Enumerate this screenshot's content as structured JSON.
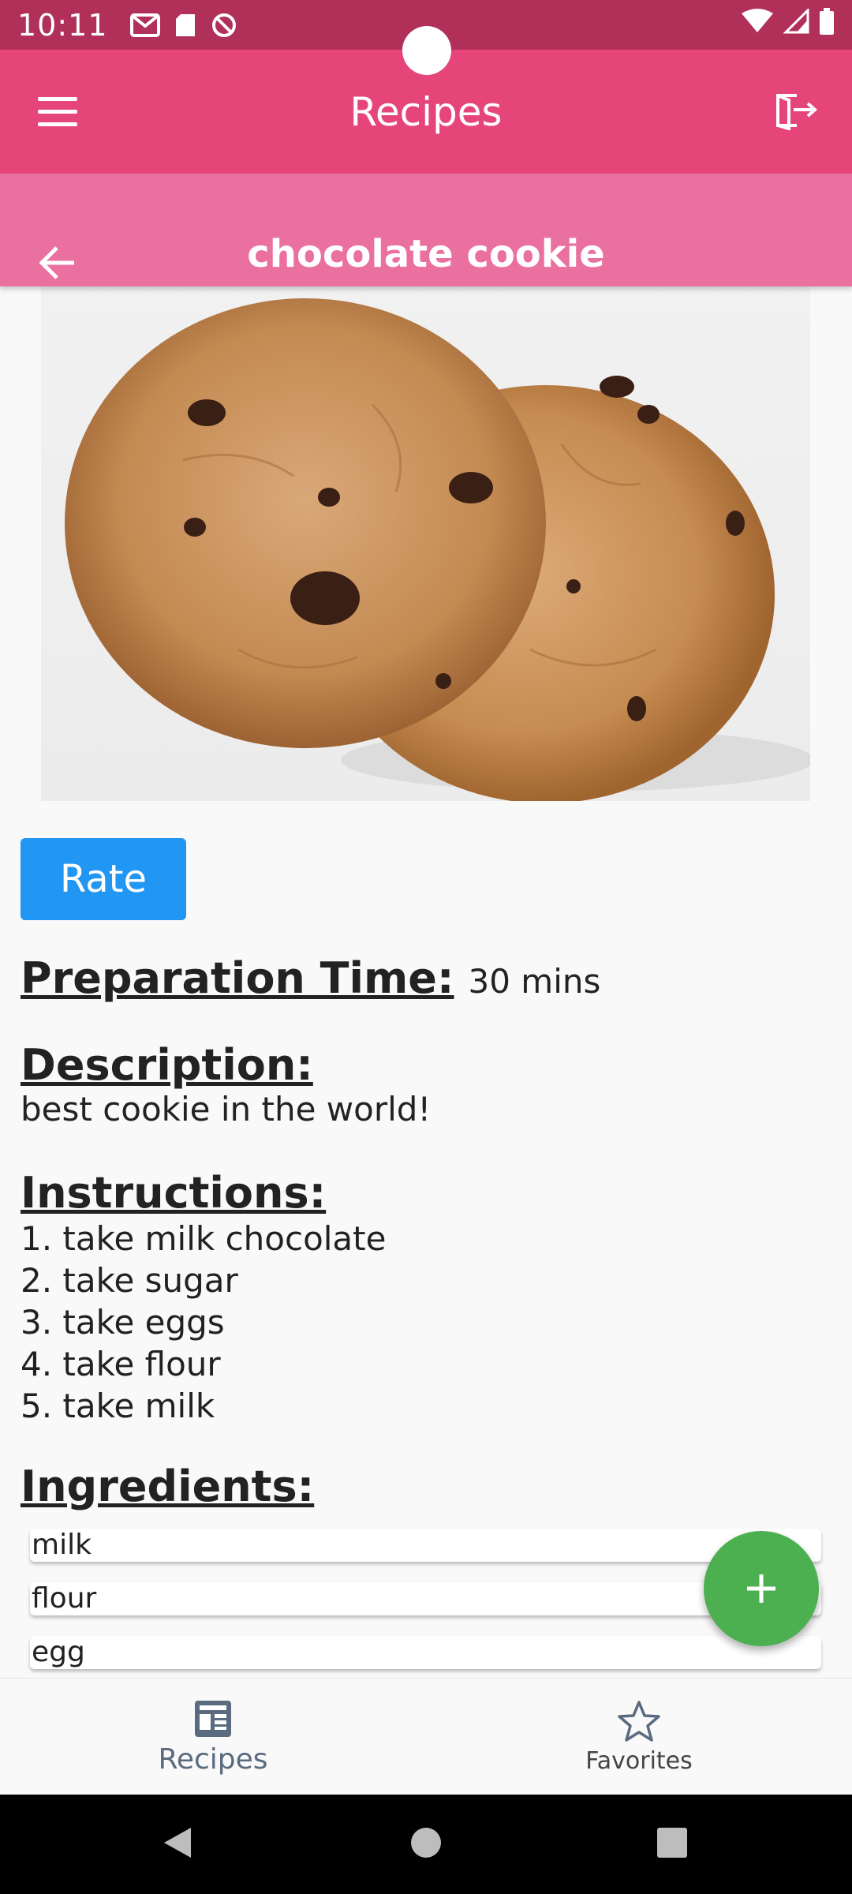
{
  "status_bar": {
    "time": "10:11"
  },
  "app_bar": {
    "title": "Recipes"
  },
  "recipe": {
    "title": "chocolate cookie",
    "rate_label": "Rate",
    "prep_label": "Preparation Time:",
    "prep_value": "30 mins",
    "description_label": "Description:",
    "description": "best cookie in the world!",
    "instructions_label": "Instructions:",
    "instructions": [
      "1. take milk chocolate",
      "2. take sugar",
      "3. take eggs",
      "4. take flour",
      "5. take milk"
    ],
    "ingredients_label": "Ingredients:",
    "ingredients": [
      "milk",
      "flour",
      "egg"
    ]
  },
  "bottom_nav": {
    "recipes_label": "Recipes",
    "favorites_label": "Favorites"
  },
  "colors": {
    "status_bar": "#b03059",
    "app_bar": "#e6457a",
    "sub_bar": "#ea70a0",
    "rate_button": "#2196f3",
    "fab": "#4caf50"
  },
  "icons": [
    "menu-icon",
    "logout-icon",
    "back-arrow-icon",
    "add-icon",
    "recipes-tab-icon",
    "star-icon",
    "nav-back-icon",
    "nav-home-icon",
    "nav-recents-icon"
  ]
}
